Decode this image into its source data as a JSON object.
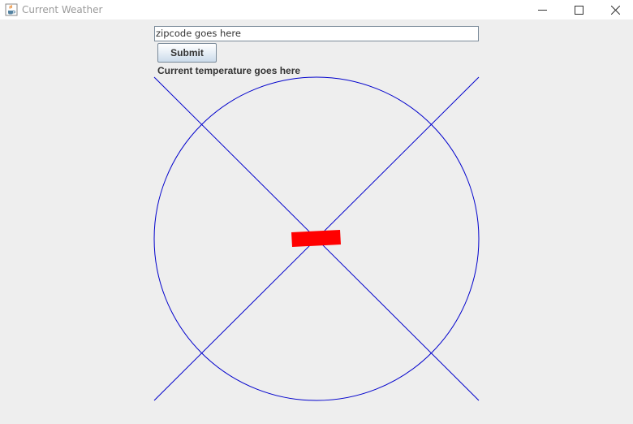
{
  "window": {
    "title": "Current Weather"
  },
  "form": {
    "zipcode_value": "zipcode goes here",
    "submit_label": "Submit",
    "temperature_text": "Current temperature goes here"
  },
  "colors": {
    "background": "#eeeeee",
    "dial_stroke": "#0000cc",
    "needle": "#ff0000"
  },
  "icons": {
    "app": "java-cup-icon",
    "minimize": "minimize-icon",
    "maximize": "maximize-icon",
    "close": "close-icon"
  }
}
